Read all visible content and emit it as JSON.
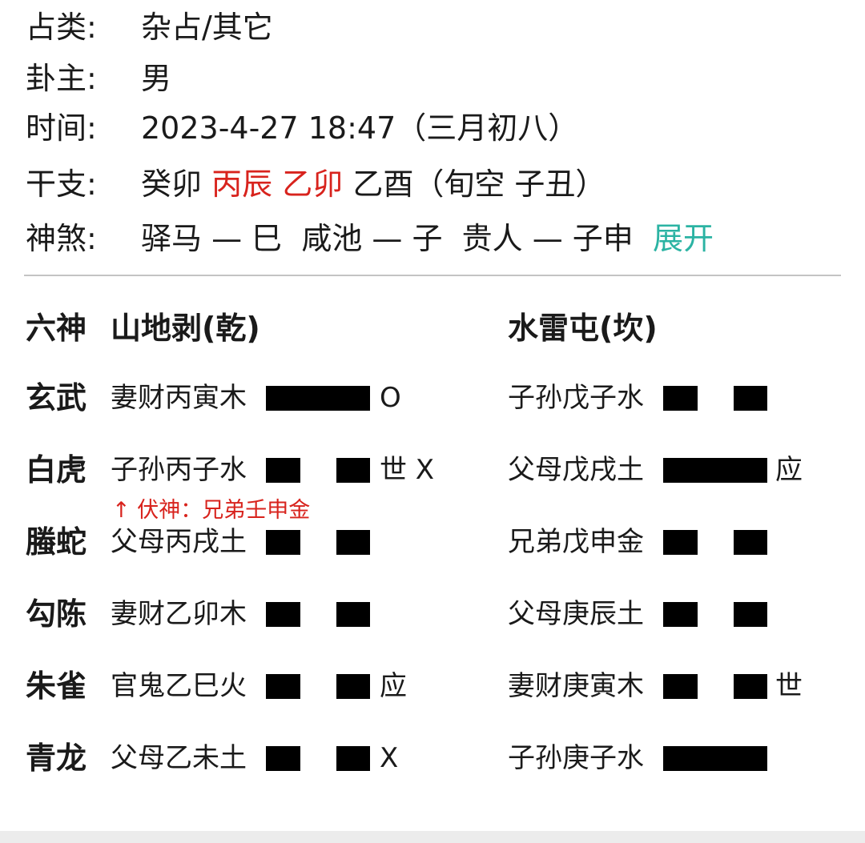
{
  "info": {
    "category": {
      "label": "占类:",
      "value": "杂占/其它"
    },
    "subject": {
      "label": "卦主:",
      "value": "男"
    },
    "time": {
      "label": "时间:",
      "value": "2023-4-27 18:47（三月初八）"
    },
    "ganzhi": {
      "label": "干支:",
      "year": "癸卯",
      "month": "丙辰",
      "day": "乙卯",
      "hour": "乙酉",
      "void": "（旬空 子丑）"
    },
    "shensha": {
      "label": "神煞:",
      "value": "驿马 — 巳  咸池 — 子  贵人 — 子申",
      "expand_label": "展开"
    }
  },
  "header": {
    "six_gods_label": "六神",
    "main_hexagram": "山地剥(乾)",
    "changed_hexagram": "水雷屯(坎)"
  },
  "rows": [
    {
      "god": "玄武",
      "main": {
        "text": "妻财丙寅木",
        "line": "yang",
        "mark": "O"
      },
      "changed": {
        "text": "子孙戊子水",
        "line": "yin",
        "mark": ""
      }
    },
    {
      "god": "白虎",
      "main": {
        "text": "子孙丙子水",
        "line": "yin",
        "mark": "世 X"
      },
      "changed": {
        "text": "父母戊戌土",
        "line": "yang",
        "mark": "应"
      }
    },
    {
      "god": "螣蛇",
      "main": {
        "text": "父母丙戌土",
        "line": "yin",
        "mark": ""
      },
      "changed": {
        "text": "兄弟戊申金",
        "line": "yin",
        "mark": ""
      }
    },
    {
      "god": "勾陈",
      "main": {
        "text": "妻财乙卯木",
        "line": "yin",
        "mark": ""
      },
      "changed": {
        "text": "父母庚辰土",
        "line": "yin",
        "mark": ""
      }
    },
    {
      "god": "朱雀",
      "main": {
        "text": "官鬼乙巳火",
        "line": "yin",
        "mark": "应"
      },
      "changed": {
        "text": "妻财庚寅木",
        "line": "yin",
        "mark": "世"
      }
    },
    {
      "god": "青龙",
      "main": {
        "text": "父母乙未土",
        "line": "yin",
        "mark": "X"
      },
      "changed": {
        "text": "子孙庚子水",
        "line": "yang",
        "mark": ""
      }
    }
  ],
  "fushen": "↑ 伏神：兄弟壬申金",
  "colors": {
    "accent_red": "#d8231d",
    "accent_teal": "#2bb3a3",
    "line_black": "#000000"
  }
}
